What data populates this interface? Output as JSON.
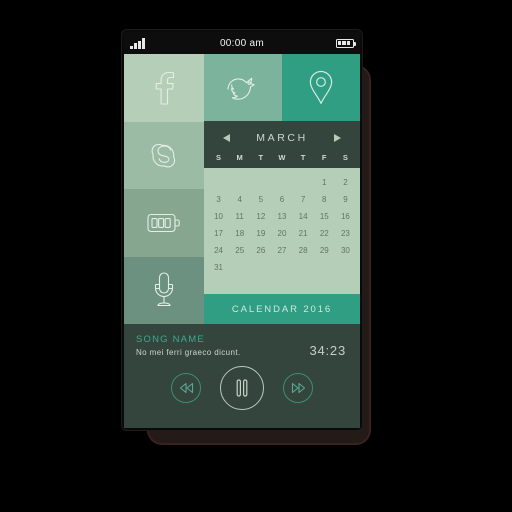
{
  "statusbar": {
    "signal_icon": "signal-bars-icon",
    "time": "00:00 am",
    "battery_icon": "battery-icon",
    "battery_segments": 3
  },
  "tiles": {
    "left_column": [
      {
        "name": "facebook",
        "icon": "facebook-icon",
        "color": "#b5ceb8"
      },
      {
        "name": "skype",
        "icon": "skype-icon",
        "color": "#9cbba4"
      },
      {
        "name": "battery",
        "icon": "battery-tile-icon",
        "color": "#87a690"
      },
      {
        "name": "microphone",
        "icon": "microphone-icon",
        "color": "#6d9180"
      }
    ],
    "top_row": [
      {
        "name": "twitter",
        "icon": "twitter-bird-icon",
        "color": "#7cb39c"
      },
      {
        "name": "location",
        "icon": "location-pin-icon",
        "color": "#2f9e83"
      }
    ]
  },
  "calendar": {
    "prev_label": "previous-month",
    "next_label": "next-month",
    "month": "MARCH",
    "weekdays": [
      "S",
      "M",
      "T",
      "W",
      "T",
      "F",
      "S"
    ],
    "leading_blanks": 5,
    "days": [
      1,
      2,
      3,
      4,
      5,
      6,
      7,
      8,
      9,
      10,
      11,
      12,
      13,
      14,
      15,
      16,
      17,
      18,
      19,
      20,
      21,
      22,
      23,
      24,
      25,
      26,
      27,
      28,
      29,
      30,
      31
    ],
    "footer": "CALENDAR 2016",
    "header_bg": "#34453d",
    "grid_bg": "#b5ceb8",
    "footer_bg": "#2f9e83"
  },
  "player": {
    "title": "SONG NAME",
    "subtitle": "No mei ferri graeco dicunt.",
    "time": "34:23",
    "prev_icon": "rewind-icon",
    "play_icon": "pause-icon",
    "next_icon": "fast-forward-icon",
    "title_color": "#3fa890",
    "bg": "#34453d"
  }
}
